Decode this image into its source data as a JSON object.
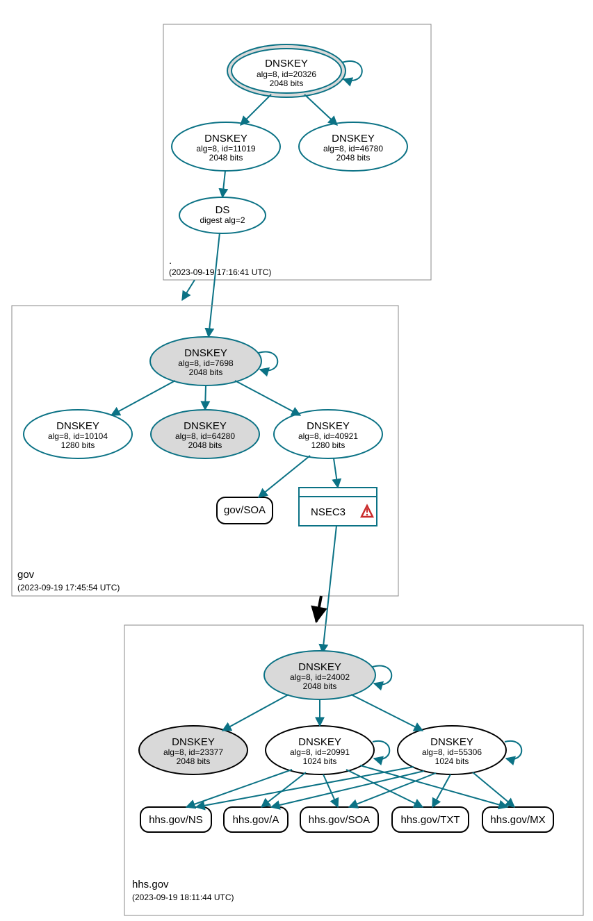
{
  "zones": {
    "root": {
      "name": ".",
      "timestamp": "(2023-09-19 17:16:41 UTC)"
    },
    "gov": {
      "name": "gov",
      "timestamp": "(2023-09-19 17:45:54 UTC)"
    },
    "hhs": {
      "name": "hhs.gov",
      "timestamp": "(2023-09-19 18:11:44 UTC)"
    }
  },
  "nodes": {
    "root_ksk": {
      "t": "DNSKEY",
      "d1": "alg=8, id=20326",
      "d2": "2048 bits"
    },
    "root_zsk1": {
      "t": "DNSKEY",
      "d1": "alg=8, id=11019",
      "d2": "2048 bits"
    },
    "root_zsk2": {
      "t": "DNSKEY",
      "d1": "alg=8, id=46780",
      "d2": "2048 bits"
    },
    "root_ds": {
      "t": "DS",
      "d1": "digest alg=2"
    },
    "gov_ksk": {
      "t": "DNSKEY",
      "d1": "alg=8, id=7698",
      "d2": "2048 bits"
    },
    "gov_zsk1": {
      "t": "DNSKEY",
      "d1": "alg=8, id=10104",
      "d2": "1280 bits"
    },
    "gov_zsk2": {
      "t": "DNSKEY",
      "d1": "alg=8, id=64280",
      "d2": "2048 bits"
    },
    "gov_zsk3": {
      "t": "DNSKEY",
      "d1": "alg=8, id=40921",
      "d2": "1280 bits"
    },
    "gov_soa": {
      "t": "gov/SOA"
    },
    "gov_nsec": {
      "t": "NSEC3"
    },
    "hhs_ksk": {
      "t": "DNSKEY",
      "d1": "alg=8, id=24002",
      "d2": "2048 bits"
    },
    "hhs_zsk1": {
      "t": "DNSKEY",
      "d1": "alg=8, id=23377",
      "d2": "2048 bits"
    },
    "hhs_zsk2": {
      "t": "DNSKEY",
      "d1": "alg=8, id=20991",
      "d2": "1024 bits"
    },
    "hhs_zsk3": {
      "t": "DNSKEY",
      "d1": "alg=8, id=55306",
      "d2": "1024 bits"
    },
    "hhs_ns": {
      "t": "hhs.gov/NS"
    },
    "hhs_a": {
      "t": "hhs.gov/A"
    },
    "hhs_soa": {
      "t": "hhs.gov/SOA"
    },
    "hhs_txt": {
      "t": "hhs.gov/TXT"
    },
    "hhs_mx": {
      "t": "hhs.gov/MX"
    }
  }
}
